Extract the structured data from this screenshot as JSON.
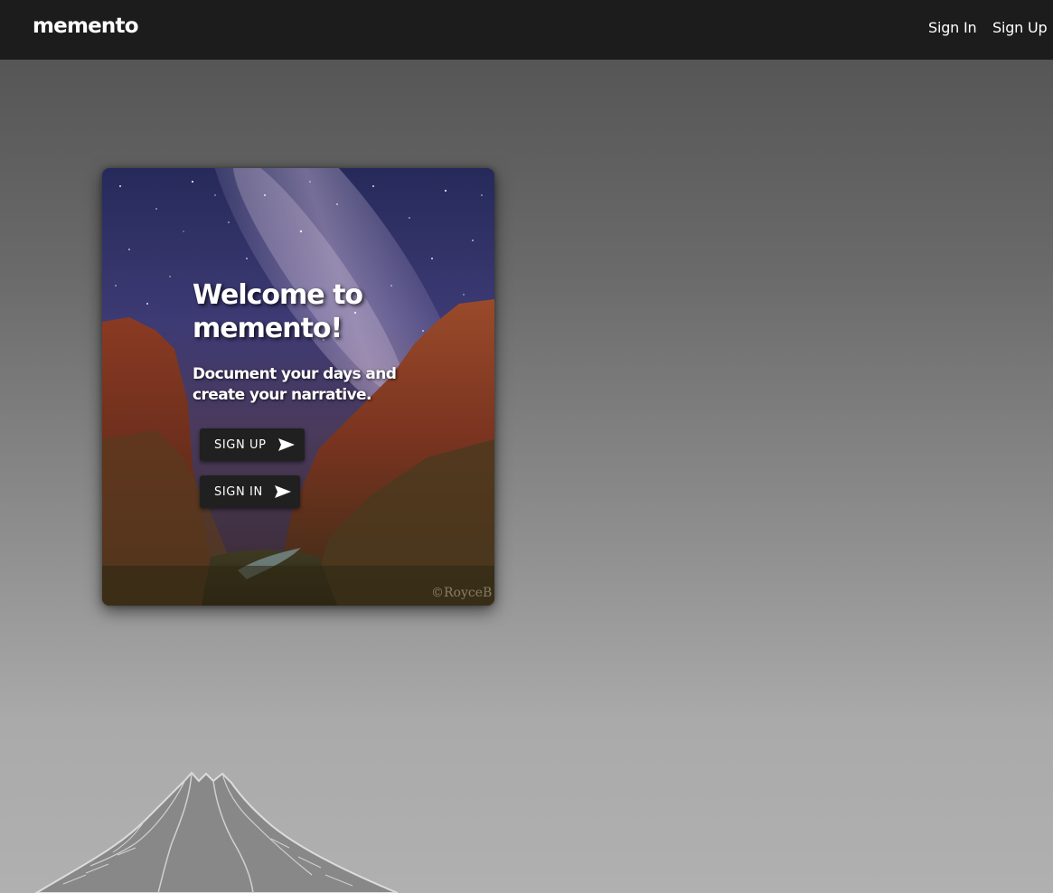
{
  "navbar": {
    "brand": "memento",
    "links": [
      {
        "label": "Sign In"
      },
      {
        "label": "Sign Up"
      }
    ],
    "background": "#1c1c1c"
  },
  "hero": {
    "title": "Welcome to memento!",
    "tagline": "Document your days and create your narrative.",
    "buttons": [
      {
        "label": "SIGN UP",
        "icon": "send-icon"
      },
      {
        "label": "SIGN IN",
        "icon": "send-icon"
      }
    ],
    "watermark": "©RoyceB"
  },
  "colors": {
    "button_bg": "#202020",
    "text": "#ffffff"
  }
}
